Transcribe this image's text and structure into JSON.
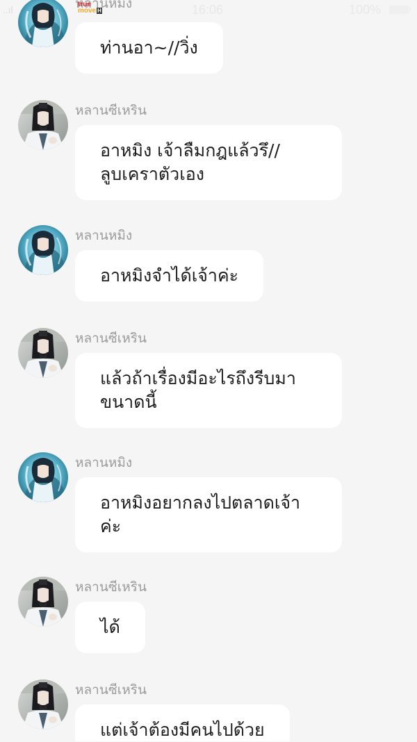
{
  "status_bar": {
    "carrier_top": "true",
    "carrier_bottom": "move",
    "carrier_badge": "H",
    "signal": "..ıl",
    "time": "16:06",
    "battery": "100%"
  },
  "messages": [
    {
      "sender": "หลานหมิง",
      "text": "ท่านอา~//วิ่ง",
      "avatar": "girl-avatar"
    },
    {
      "sender": "หลานซีเหริน",
      "text": "อาหมิง เจ้าลืมกฎแล้วรึ//\nลูบเคราตัวเอง",
      "avatar": "elder-avatar"
    },
    {
      "sender": "หลานหมิง",
      "text": "อาหมิงจำได้เจ้าค่ะ",
      "avatar": "girl-avatar"
    },
    {
      "sender": "หลานซีเหริน",
      "text": "แล้วถ้าเรื่องมีอะไรถึงรีบมา\nขนาดนี้",
      "avatar": "elder-avatar"
    },
    {
      "sender": "หลานหมิง",
      "text": "อาหมิงอยากลงไปตลาดเจ้า\nค่ะ",
      "avatar": "girl-avatar"
    },
    {
      "sender": "หลานซีเหริน",
      "text": "ได้",
      "avatar": "elder-avatar"
    },
    {
      "sender": "หลานซีเหริน",
      "text": "แต่เจ้าต้องมีคนไปด้วย",
      "avatar": "elder-avatar"
    }
  ]
}
